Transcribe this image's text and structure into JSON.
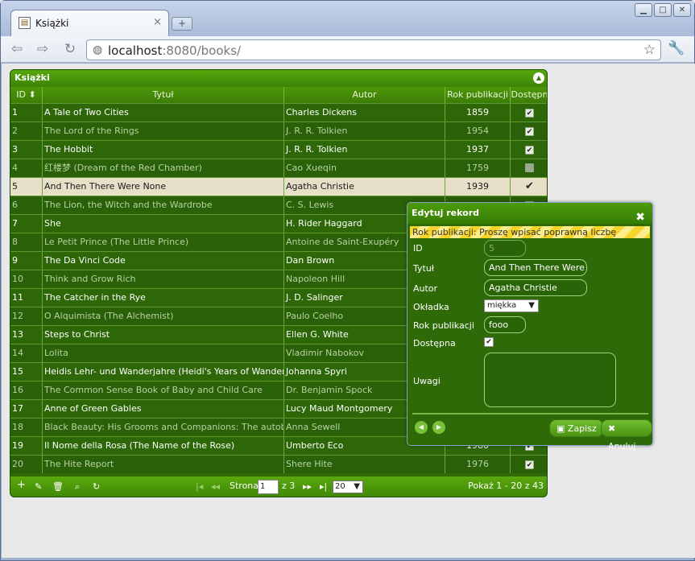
{
  "browser": {
    "tab_title": "Książki",
    "favicon": "book-icon",
    "url_host": "localhost",
    "url_rest": ":8080/books/"
  },
  "grid": {
    "title": "Książki",
    "columns": [
      "ID",
      "Tytuł",
      "Autor",
      "Rok publikacji",
      "Dostępn"
    ],
    "rows": [
      {
        "id": "1",
        "title": "A Tale of Two Cities",
        "author": "Charles Dickens",
        "year": "1859",
        "available": true
      },
      {
        "id": "2",
        "title": "The Lord of the Rings",
        "author": "J. R. R. Tolkien",
        "year": "1954",
        "available": true
      },
      {
        "id": "3",
        "title": "The Hobbit",
        "author": "J. R. R. Tolkien",
        "year": "1937",
        "available": true
      },
      {
        "id": "4",
        "title": "红楼梦 (Dream of the Red Chamber)",
        "author": "Cao Xueqin",
        "year": "1759",
        "available": false
      },
      {
        "id": "5",
        "title": "And Then There Were None",
        "author": "Agatha Christie",
        "year": "1939",
        "available": true
      },
      {
        "id": "6",
        "title": "The Lion, the Witch and the Wardrobe",
        "author": "C. S. Lewis",
        "year": "",
        "available": true
      },
      {
        "id": "7",
        "title": "She",
        "author": "H. Rider Haggard",
        "year": "",
        "available": true
      },
      {
        "id": "8",
        "title": "Le Petit Prince (The Little Prince)",
        "author": "Antoine de Saint-Exupéry",
        "year": "",
        "available": true
      },
      {
        "id": "9",
        "title": "The Da Vinci Code",
        "author": "Dan Brown",
        "year": "",
        "available": true
      },
      {
        "id": "10",
        "title": "Think and Grow Rich",
        "author": "Napoleon Hill",
        "year": "",
        "available": true
      },
      {
        "id": "11",
        "title": "The Catcher in the Rye",
        "author": "J. D. Salinger",
        "year": "",
        "available": true
      },
      {
        "id": "12",
        "title": "O Alquimista (The Alchemist)",
        "author": "Paulo Coelho",
        "year": "",
        "available": true
      },
      {
        "id": "13",
        "title": "Steps to Christ",
        "author": "Ellen G. White",
        "year": "",
        "available": true
      },
      {
        "id": "14",
        "title": "Lolita",
        "author": "Vladimir Nabokov",
        "year": "",
        "available": true
      },
      {
        "id": "15",
        "title": "Heidis Lehr- und Wanderjahre (Heidi's Years of Wandering and",
        "author": "Johanna Spyri",
        "year": "",
        "available": true
      },
      {
        "id": "16",
        "title": "The Common Sense Book of Baby and Child Care",
        "author": "Dr. Benjamin Spock",
        "year": "",
        "available": true
      },
      {
        "id": "17",
        "title": "Anne of Green Gables",
        "author": "Lucy Maud Montgomery",
        "year": "",
        "available": true
      },
      {
        "id": "18",
        "title": "Black Beauty: His Grooms and Companions: The autobiograph",
        "author": "Anna Sewell",
        "year": "",
        "available": true
      },
      {
        "id": "19",
        "title": "Il Nome della Rosa (The Name of the Rose)",
        "author": "Umberto Eco",
        "year": "1980",
        "available": true
      },
      {
        "id": "20",
        "title": "The Hite Report",
        "author": "Shere Hite",
        "year": "1976",
        "available": true
      }
    ],
    "footer": {
      "page_label": "Strona",
      "page_value": "1",
      "page_of": "z 3",
      "per_page": "20",
      "summary": "Pokaż 1 - 20 z 43"
    }
  },
  "dialog": {
    "title": "Edytuj rekord",
    "error": "Rok publikacji: Proszę wpisać poprawną liczbę",
    "labels": {
      "id": "ID",
      "title": "Tytuł",
      "author": "Autor",
      "cover": "Okładka",
      "year": "Rok publikacji",
      "available": "Dostępna",
      "notes": "Uwagi"
    },
    "values": {
      "id": "5",
      "title": "And Then There Were N",
      "author": "Agatha Christie",
      "cover": "miękka",
      "year": "fooo",
      "available": true
    },
    "save": "Zapisz",
    "cancel": "Anuluj"
  }
}
